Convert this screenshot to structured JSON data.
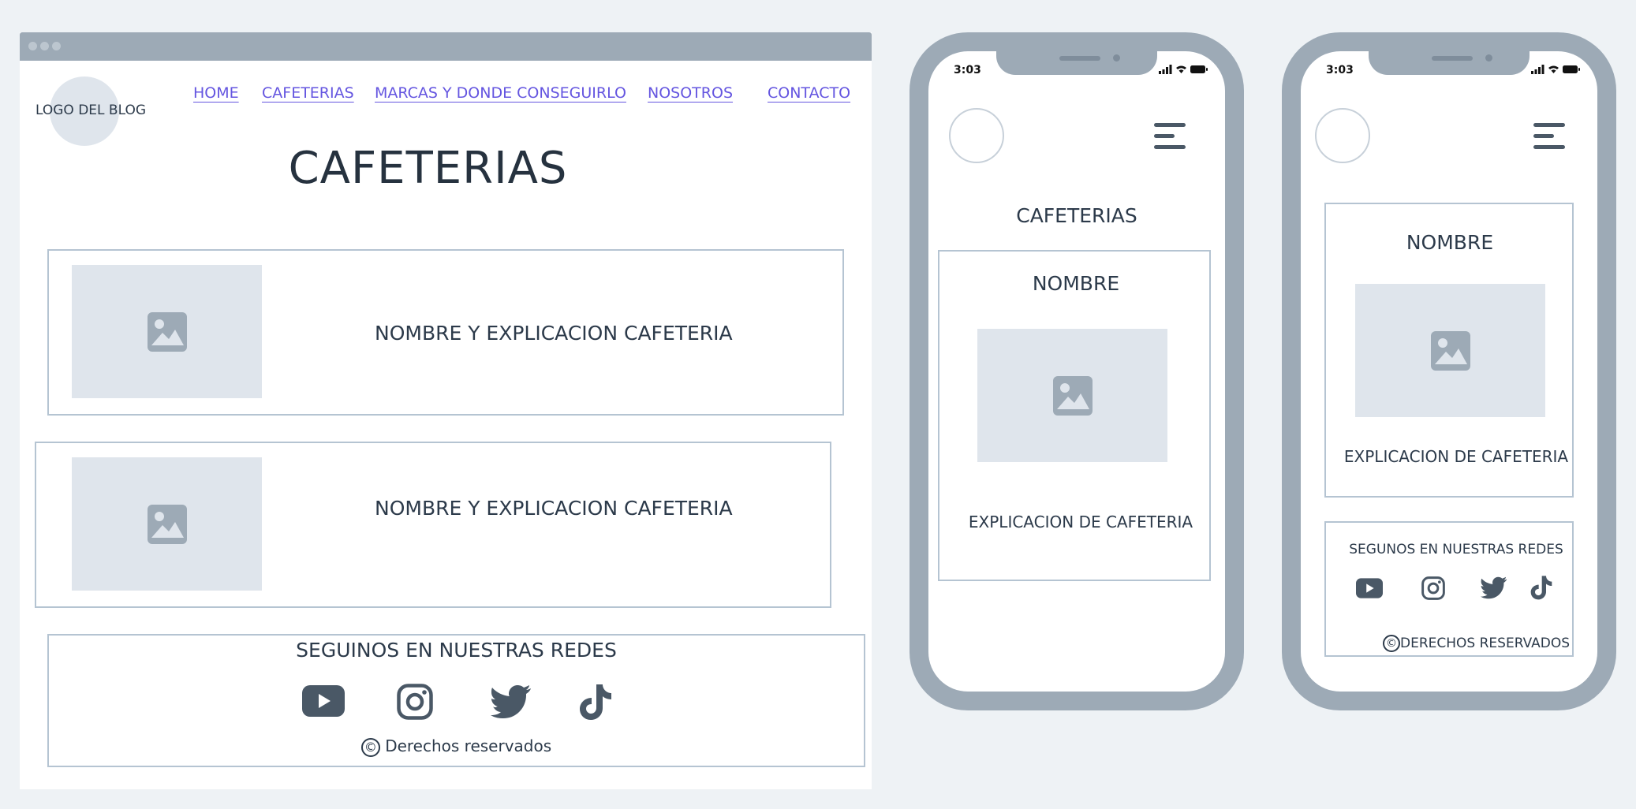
{
  "desktop": {
    "logo_text": "LOGO DEL BLOG",
    "nav": [
      {
        "label": "HOME"
      },
      {
        "label": "CAFETERIAS"
      },
      {
        "label": "MARCAS Y DONDE CONSEGUIRLO"
      },
      {
        "label": "NOSOTROS"
      },
      {
        "label": "CONTACTO"
      }
    ],
    "title": "CAFETERIAS",
    "cards": [
      {
        "text": "NOMBRE Y EXPLICACION CAFETERIA",
        "image_icon": "image-icon"
      },
      {
        "text": "NOMBRE Y EXPLICACION CAFETERIA",
        "image_icon": "image-icon"
      }
    ],
    "social": {
      "title": "SEGUINOS EN NUESTRAS REDES",
      "icons": [
        "youtube-icon",
        "instagram-icon",
        "twitter-icon",
        "tiktok-icon"
      ],
      "copyright_symbol": "©",
      "rights": "Derechos reservados"
    }
  },
  "phone1": {
    "time": "3:03",
    "title": "CAFETERIAS",
    "card_name": "NOMBRE",
    "card_desc": "EXPLICACION DE CAFETERIA"
  },
  "phone2": {
    "time": "3:03",
    "card_name": "NOMBRE",
    "card_desc": "EXPLICACION  DE CAFETERIA",
    "social_title": "SEGUNOS EN NUESTRAS REDES",
    "copyright_symbol": "©",
    "rights": "DERECHOS RESERVADOS"
  },
  "colors": {
    "frame": "#9daab6",
    "placeholder": "#dfe5ec",
    "link": "#6455e0",
    "text": "#2c3a4a",
    "border": "#b5c4d2",
    "icon": "#4a5866"
  }
}
